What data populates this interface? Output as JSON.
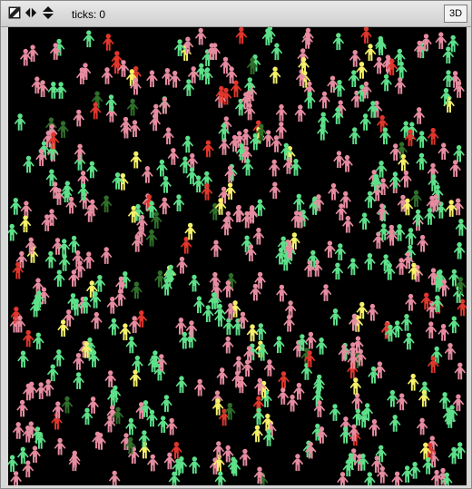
{
  "toolbar": {
    "icons": [
      "resize-icon",
      "pan-arrows-icon",
      "move-arrows-icon"
    ],
    "ticks_label": "ticks:",
    "ticks_value": "0",
    "view3d_label": "3D"
  },
  "colors": {
    "background": "#000000",
    "pink": "#e68ca0",
    "green": "#5ee08a",
    "yellow": "#f5f06a",
    "red": "#e0362c",
    "dark_green": "#2f6f2a"
  },
  "agents": {
    "shape": "person-icon",
    "approximate_count": 600,
    "color_mix": {
      "pink": 0.42,
      "green": 0.42,
      "yellow": 0.07,
      "red": 0.05,
      "dark_green": 0.04
    }
  }
}
